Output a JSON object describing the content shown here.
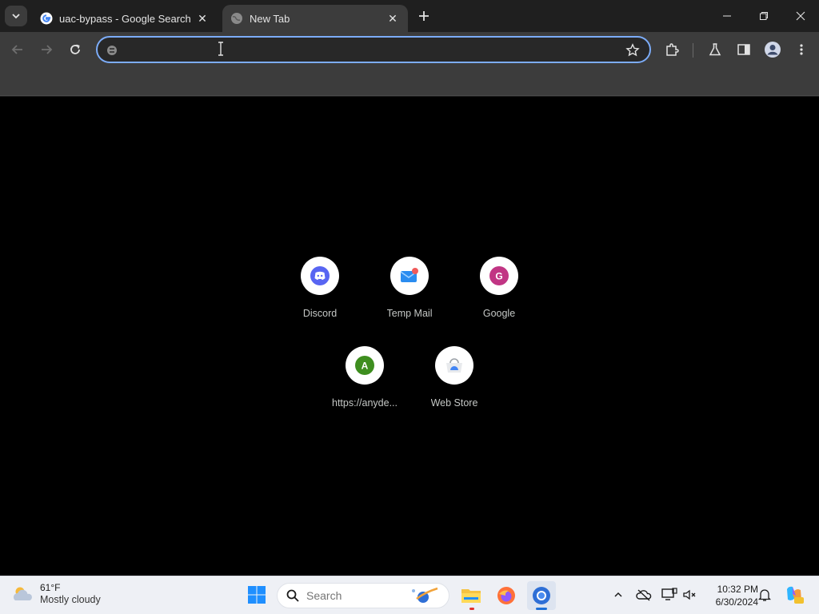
{
  "tabs": [
    {
      "title": "uac-bypass - Google Search",
      "active": false,
      "favicon": "google-g-icon"
    },
    {
      "title": "New Tab",
      "active": true,
      "favicon": "globe-icon"
    }
  ],
  "omnibox": {
    "value": "",
    "placeholder": ""
  },
  "shortcuts": [
    {
      "label": "Discord",
      "icon": "discord-icon",
      "color": "#5865F2"
    },
    {
      "label": "Temp Mail",
      "icon": "temp-mail-icon",
      "color": "#2A8CF0"
    },
    {
      "label": "Google",
      "icon": "letter-g-icon",
      "letter": "G",
      "color": "#C13584"
    },
    {
      "label": "https://anyde...",
      "icon": "letter-a-icon",
      "letter": "A",
      "color": "#3E8E1F"
    },
    {
      "label": "Web Store",
      "icon": "web-store-icon",
      "color": "#4285F4"
    }
  ],
  "taskbar": {
    "weather": {
      "temp": "61°F",
      "condition": "Mostly cloudy"
    },
    "search_label": "Search",
    "clock": {
      "time": "10:32 PM",
      "date": "6/30/2024"
    }
  },
  "colors": {
    "accent": "#7cacf8",
    "tab_active": "#3c3c3c",
    "frame": "#1f1f1f"
  }
}
